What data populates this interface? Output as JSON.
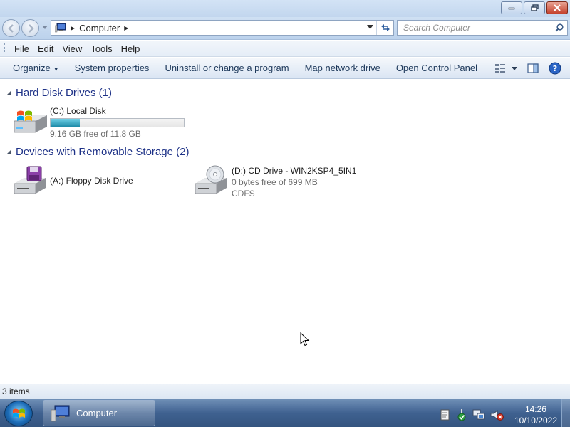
{
  "window": {
    "controls": [
      "minimize-icon",
      "restore-icon",
      "close-icon"
    ]
  },
  "navigation": {
    "address_segments": [
      "Computer"
    ],
    "search_placeholder": "Search Computer",
    "icons": [
      "back-icon",
      "forward-icon",
      "computer-icon",
      "refresh-icon",
      "search-icon"
    ]
  },
  "menubar": {
    "items": [
      "File",
      "Edit",
      "View",
      "Tools",
      "Help"
    ]
  },
  "commandbar": {
    "organize": "Organize",
    "items": [
      "System properties",
      "Uninstall or change a program",
      "Map network drive",
      "Open Control Panel"
    ],
    "icons": [
      "view-options-icon",
      "preview-pane-icon",
      "help-icon"
    ]
  },
  "groups": [
    {
      "title": "Hard Disk Drives (1)",
      "items": [
        {
          "name": "(C:) Local Disk",
          "free_text": "9.16 GB free of 11.8 GB",
          "used_fraction": 0.22,
          "icon": "hard-disk-icon"
        }
      ]
    },
    {
      "title": "Devices with Removable Storage (2)",
      "items": [
        {
          "name": "(A:) Floppy Disk Drive",
          "icon": "floppy-drive-icon"
        },
        {
          "name": "(D:) CD Drive - WIN2KSP4_5IN1",
          "free_text": "0 bytes free of 699 MB",
          "filesystem": "CDFS",
          "icon": "cd-drive-icon"
        }
      ]
    }
  ],
  "statusbar": {
    "text": "3 items"
  },
  "taskbar": {
    "start": "start-orb-icon",
    "task_label": "Computer",
    "tray_icons": [
      "notes-icon",
      "action-center-icon",
      "network-icon",
      "volume-muted-icon"
    ],
    "time": "14:26",
    "date": "10/10/2022"
  },
  "colors": {
    "accent": "#1e3287",
    "capacity_fill": "#1e8ba8",
    "taskbar": "#3f6190"
  }
}
